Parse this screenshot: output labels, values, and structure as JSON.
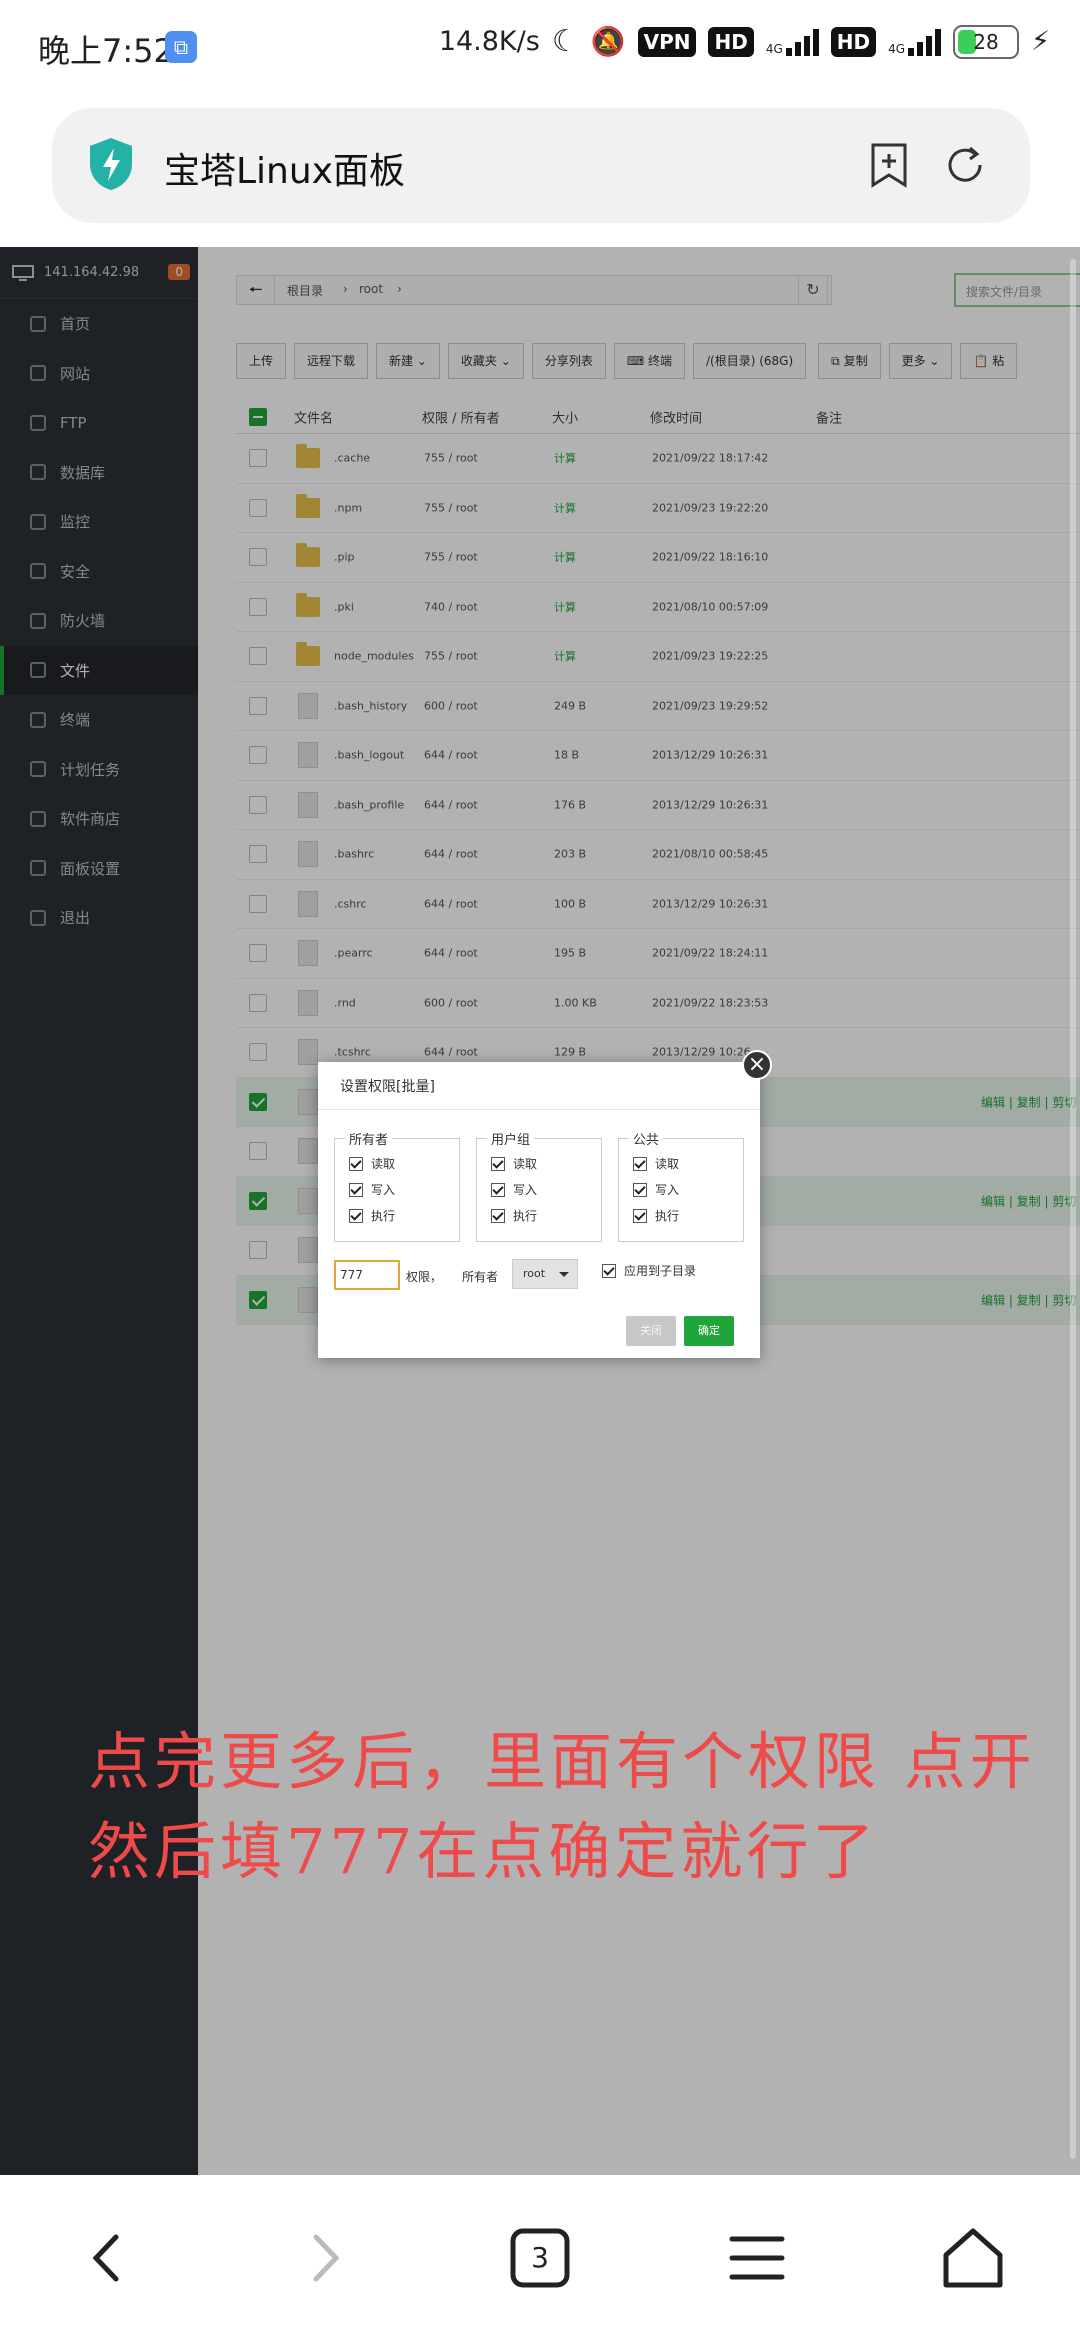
{
  "status_bar": {
    "time": "晚上7:52",
    "net_speed": "14.8K/s",
    "vpn": "VPN",
    "hd1": "HD",
    "hd2": "HD",
    "net1": "4G",
    "net2": "4G",
    "battery": "28"
  },
  "browser": {
    "title": "宝塔Linux面板",
    "tab_count": "3"
  },
  "sidebar": {
    "ip": "141.164.42.98",
    "badge": "0",
    "items": [
      {
        "label": "首页"
      },
      {
        "label": "网站"
      },
      {
        "label": "FTP"
      },
      {
        "label": "数据库"
      },
      {
        "label": "监控"
      },
      {
        "label": "安全"
      },
      {
        "label": "防火墙"
      },
      {
        "label": "文件",
        "active": true
      },
      {
        "label": "终端"
      },
      {
        "label": "计划任务"
      },
      {
        "label": "软件商店"
      },
      {
        "label": "面板设置"
      },
      {
        "label": "退出"
      }
    ]
  },
  "path": {
    "root": "根目录",
    "dir": "root",
    "search_placeholder": "搜索文件/目录"
  },
  "toolbar": {
    "upload": "上传",
    "remote_download": "远程下载",
    "new": "新建",
    "favorites": "收藏夹",
    "share_list": "分享列表",
    "terminal": "终端",
    "disk": "/(根目录) (68G)",
    "copy": "复制",
    "more": "更多",
    "paste": "粘"
  },
  "table": {
    "headers": {
      "name": "文件名",
      "perm": "权限 / 所有者",
      "size": "大小",
      "mtime": "修改时间",
      "note": "备注"
    },
    "ops_label": "编辑 | 复制 | 剪切 | 重命",
    "rows": [
      {
        "name": ".cache",
        "perm": "755 / root",
        "size": "计算",
        "mtime": "2021/09/22 18:17:42",
        "type": "folder"
      },
      {
        "name": ".npm",
        "perm": "755 / root",
        "size": "计算",
        "mtime": "2021/09/23 19:22:20",
        "type": "folder"
      },
      {
        "name": ".pip",
        "perm": "755 / root",
        "size": "计算",
        "mtime": "2021/09/22 18:16:10",
        "type": "folder"
      },
      {
        "name": ".pki",
        "perm": "740 / root",
        "size": "计算",
        "mtime": "2021/08/10 00:57:09",
        "type": "folder"
      },
      {
        "name": "node_modules",
        "perm": "755 / root",
        "size": "计算",
        "mtime": "2021/09/23 19:22:25",
        "type": "folder"
      },
      {
        "name": ".bash_history",
        "perm": "600 / root",
        "size": "249 B",
        "mtime": "2021/09/23 19:29:52",
        "type": "file"
      },
      {
        "name": ".bash_logout",
        "perm": "644 / root",
        "size": "18 B",
        "mtime": "2013/12/29 10:26:31",
        "type": "file"
      },
      {
        "name": ".bash_profile",
        "perm": "644 / root",
        "size": "176 B",
        "mtime": "2013/12/29 10:26:31",
        "type": "file"
      },
      {
        "name": ".bashrc",
        "perm": "644 / root",
        "size": "203 B",
        "mtime": "2021/08/10 00:58:45",
        "type": "file"
      },
      {
        "name": ".cshrc",
        "perm": "644 / root",
        "size": "100 B",
        "mtime": "2013/12/29 10:26:31",
        "type": "file"
      },
      {
        "name": ".pearrc",
        "perm": "644 / root",
        "size": "195 B",
        "mtime": "2021/09/22 18:24:11",
        "type": "file"
      },
      {
        "name": ".rnd",
        "perm": "600 / root",
        "size": "1.00 KB",
        "mtime": "2021/09/22 18:23:53",
        "type": "file"
      },
      {
        "name": ".tcshrc",
        "perm": "644 / root",
        "size": "129 B",
        "mtime": "2013/12/29 10:26",
        "type": "file"
      },
      {
        "name": "",
        "perm": "",
        "size": "",
        "mtime": "",
        "type": "file",
        "selected": true
      },
      {
        "name": "",
        "perm": "",
        "size": "",
        "mtime": "",
        "type": "file"
      },
      {
        "name": "",
        "perm": "",
        "size": "",
        "mtime": "",
        "type": "file",
        "selected": true
      },
      {
        "name": "",
        "perm": "",
        "size": "",
        "mtime": "",
        "type": "file"
      },
      {
        "name": "",
        "perm": "",
        "size": "",
        "mtime": "",
        "type": "file",
        "selected": true
      }
    ]
  },
  "dialog": {
    "title": "设置权限[批量]",
    "groups": [
      {
        "title": "所有者"
      },
      {
        "title": "用户组"
      },
      {
        "title": "公共"
      }
    ],
    "perms": [
      "读取",
      "写入",
      "执行"
    ],
    "perm_value": "777",
    "perm_label": "权限，",
    "owner_label": "所有者",
    "owner_value": "root",
    "recursive_label": "应用到子目录",
    "close_label": "关闭",
    "ok_label": "确定"
  },
  "annotation": "点完更多后，里面有个权限 点开然后填777在点确定就行了"
}
